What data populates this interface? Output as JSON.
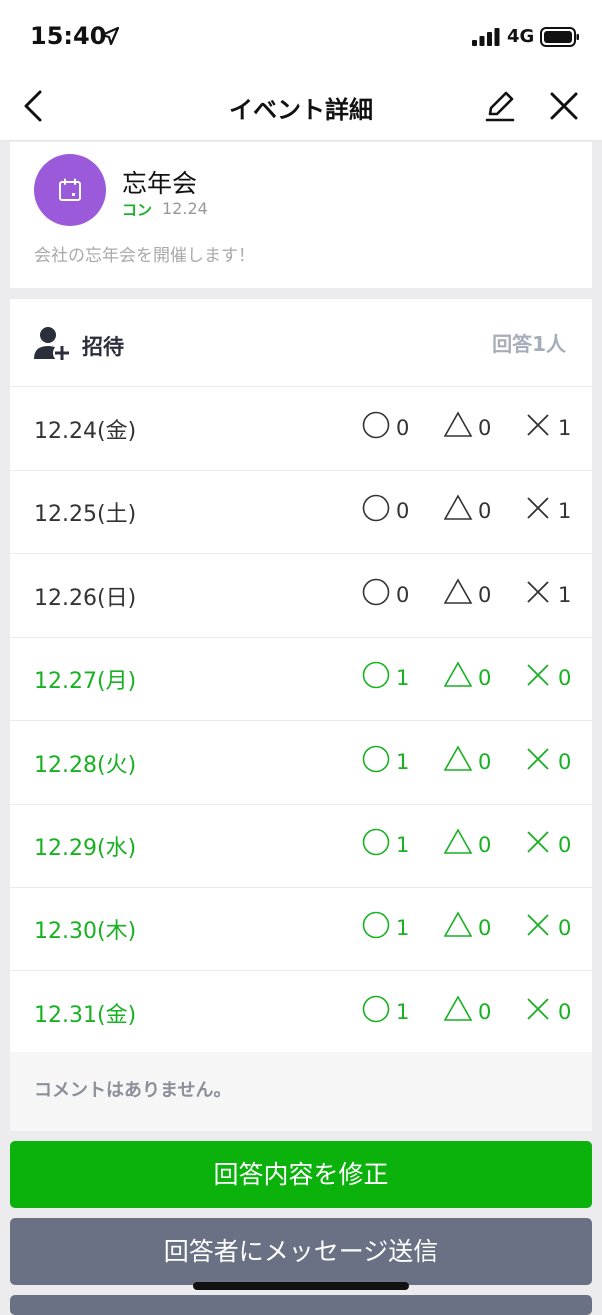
{
  "status_bar": {
    "time": "15:40",
    "network": "4G"
  },
  "nav": {
    "title": "イベント詳細"
  },
  "event": {
    "name": "忘年会",
    "organizer": "コン",
    "date": "12.24",
    "description": "会社の忘年会を開催します！",
    "avatar_color": "#9b5ad9"
  },
  "invite": {
    "label": "招待",
    "answer_count": "回答1人"
  },
  "rows": [
    {
      "date": "12.24(金)",
      "ok": "0",
      "maybe": "0",
      "ng": "1",
      "highlight": false
    },
    {
      "date": "12.25(土)",
      "ok": "0",
      "maybe": "0",
      "ng": "1",
      "highlight": false
    },
    {
      "date": "12.26(日)",
      "ok": "0",
      "maybe": "0",
      "ng": "1",
      "highlight": false
    },
    {
      "date": "12.27(月)",
      "ok": "1",
      "maybe": "0",
      "ng": "0",
      "highlight": true
    },
    {
      "date": "12.28(火)",
      "ok": "1",
      "maybe": "0",
      "ng": "0",
      "highlight": true
    },
    {
      "date": "12.29(水)",
      "ok": "1",
      "maybe": "0",
      "ng": "0",
      "highlight": true
    },
    {
      "date": "12.30(木)",
      "ok": "1",
      "maybe": "0",
      "ng": "0",
      "highlight": true
    },
    {
      "date": "12.31(金)",
      "ok": "1",
      "maybe": "0",
      "ng": "0",
      "highlight": true
    }
  ],
  "comments": {
    "text": "コメントはありません。"
  },
  "buttons": {
    "edit_answer": "回答内容を修正",
    "message_answerers": "回答者にメッセージ送信"
  },
  "colors": {
    "green": "#18b122",
    "grey_text": "#333333",
    "button_green": "#0bb20b",
    "button_grey": "#6a7184"
  }
}
